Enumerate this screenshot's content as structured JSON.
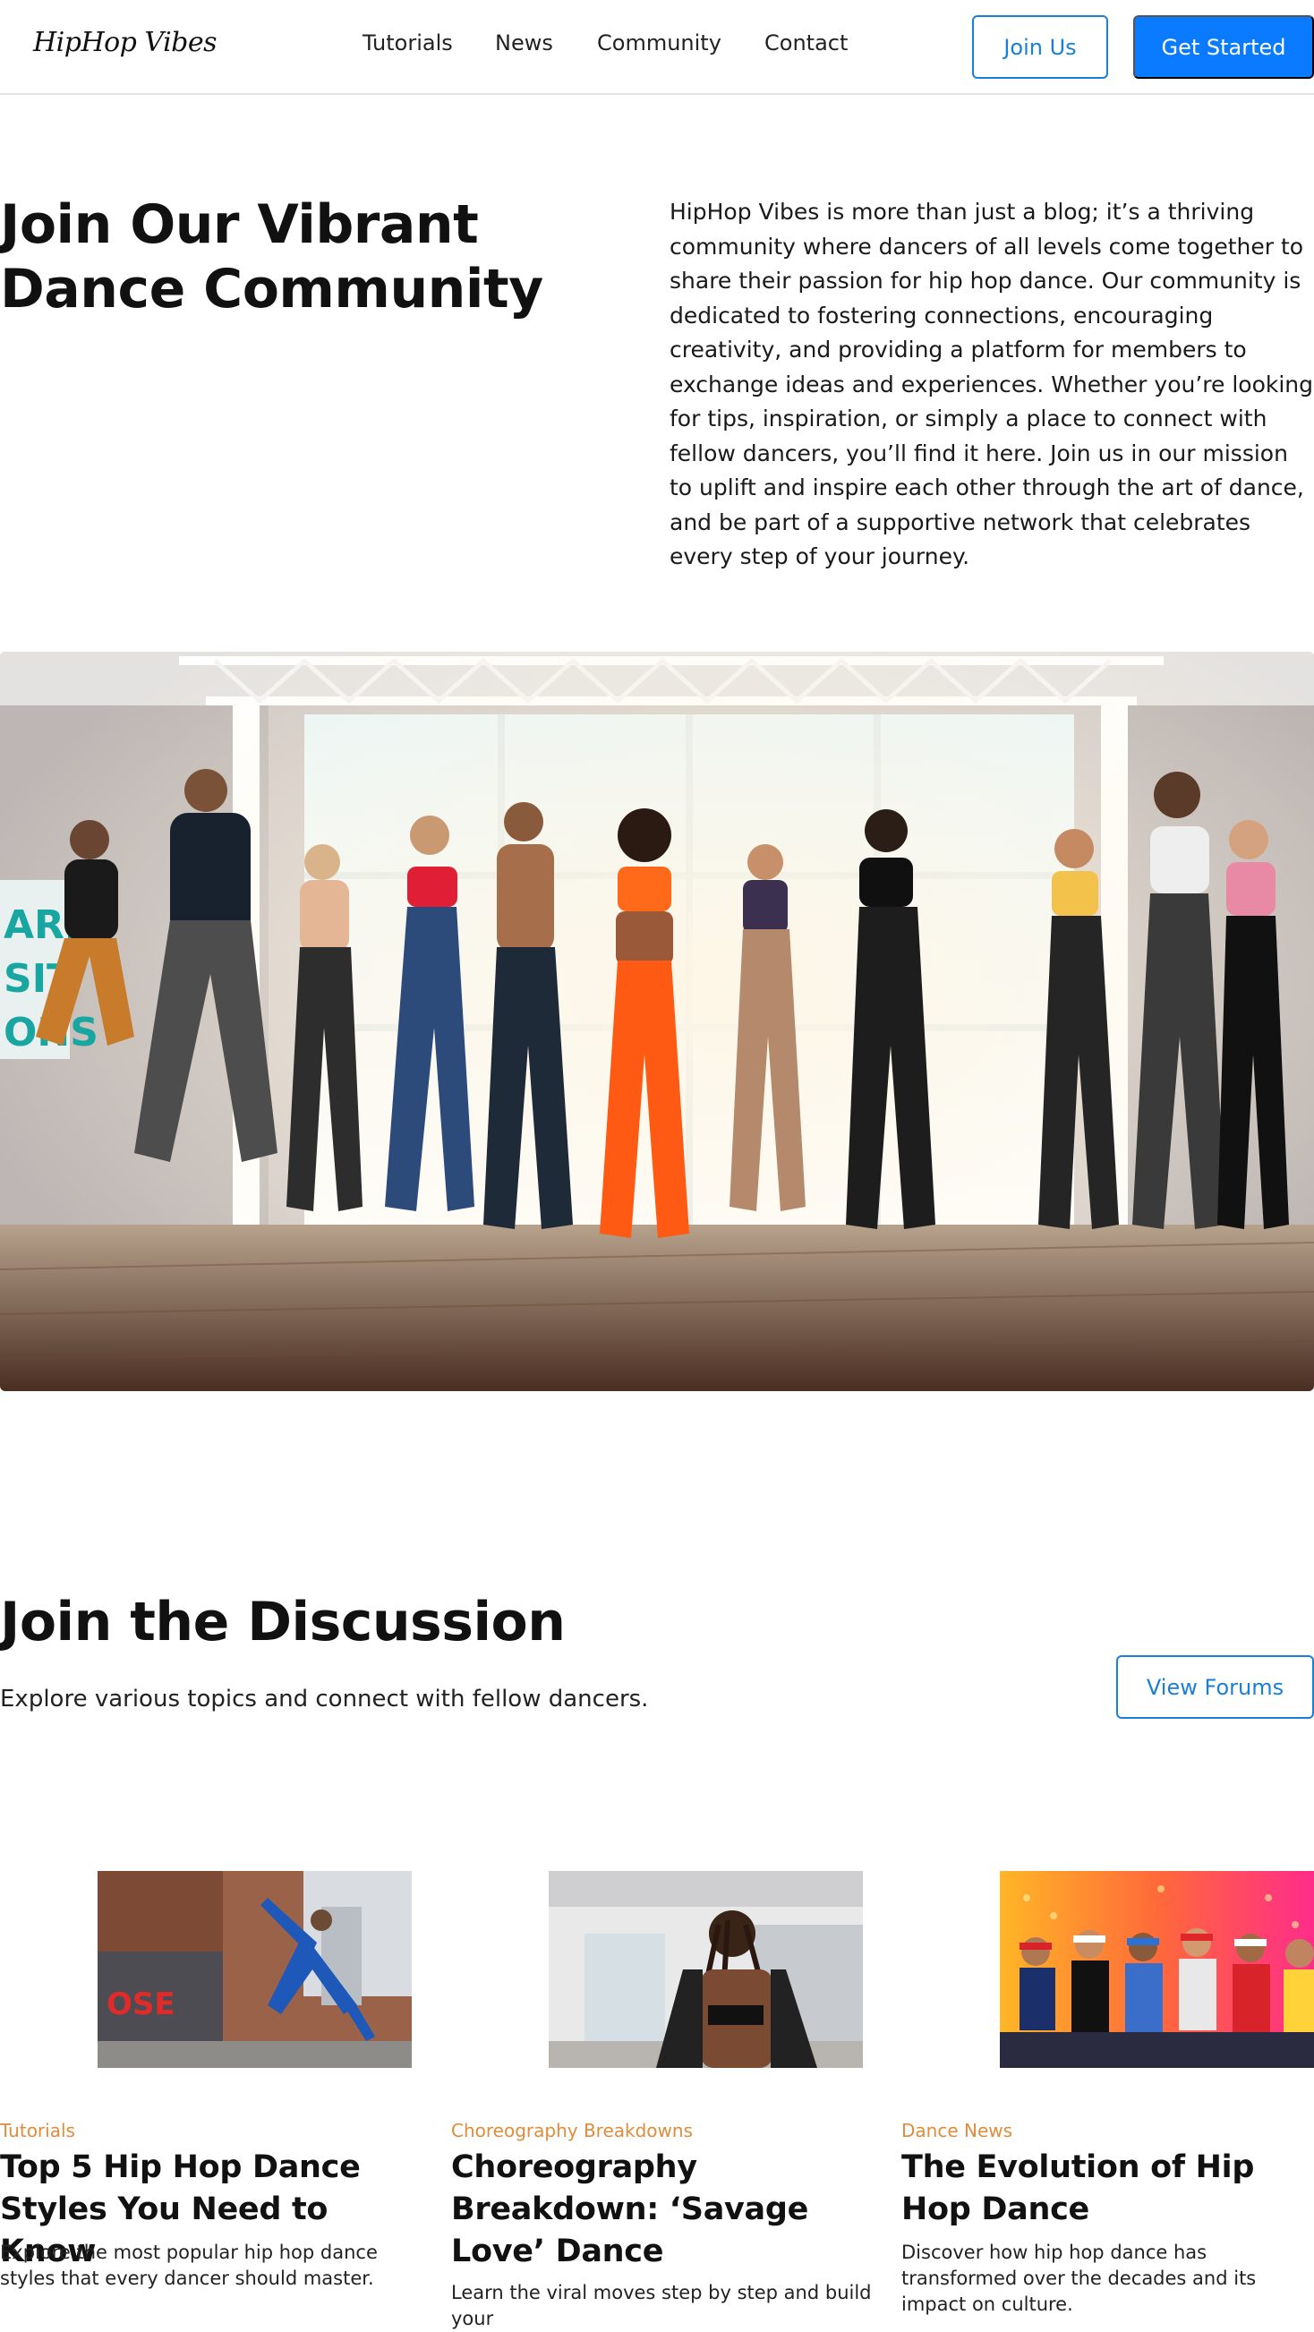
{
  "nav": {
    "logo": "HipHop Vibes",
    "links": [
      "Tutorials",
      "News",
      "Community",
      "Contact"
    ],
    "join_label": "Join Us",
    "get_started_label": "Get Started"
  },
  "hero": {
    "title": "Join Our Vibrant Dance Community",
    "body": "HipHop Vibes is more than just a blog; it’s a thriving community where dancers of all levels come together to share their passion for hip hop dance. Our community is dedicated to fostering connections, encouraging creativity, and providing a platform for members to exchange ideas and experiences. Whether you’re looking for tips, inspiration, or simply a place to connect with fellow dancers, you’ll find it here. Join us in our mission to uplift and inspire each other through the art of dance, and be part of a supportive network that celebrates every step of your journey."
  },
  "discussion": {
    "title": "Join the Discussion",
    "subtitle": "Explore various topics and connect with fellow dancers.",
    "view_forums_label": "View Forums"
  },
  "cards": [
    {
      "category": "Tutorials",
      "title": "Top 5 Hip Hop Dance Styles You Need to Know",
      "description": "Explore the most popular hip hop dance styles that every dancer should master."
    },
    {
      "category": "Choreography Breakdowns",
      "title": "Choreography Breakdown: ‘Savage Love’ Dance",
      "description": "Learn the viral moves step by step and build your"
    },
    {
      "category": "Dance News",
      "title": "The Evolution of Hip Hop Dance",
      "description": "Discover how hip hop dance has transformed over the decades and its impact on culture."
    }
  ],
  "colors": {
    "accent": "#0a7bff",
    "accent_outline": "#1a7fd6",
    "category": "#e08c3a"
  }
}
